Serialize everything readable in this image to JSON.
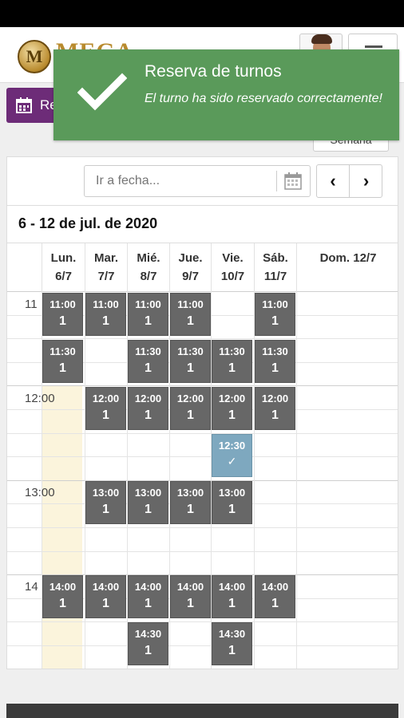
{
  "app": {
    "logo_letter": "M",
    "logo_text": "MEGA"
  },
  "tab": {
    "label": "Re"
  },
  "view_toggle": {
    "label": "Semana"
  },
  "toast": {
    "title": "Reserva de turnos",
    "message": "El turno ha sido reservado correctamente!",
    "color": "#5a9a5a"
  },
  "calendar": {
    "date_placeholder": "Ir a fecha...",
    "range_title": "6 - 12 de jul. de 2020",
    "days": [
      {
        "name": "Lun.",
        "date": "6/7"
      },
      {
        "name": "Mar.",
        "date": "7/7"
      },
      {
        "name": "Mié.",
        "date": "8/7"
      },
      {
        "name": "Jue.",
        "date": "9/7"
      },
      {
        "name": "Vie.",
        "date": "10/7"
      },
      {
        "name": "Sáb.",
        "date": "11/7"
      },
      {
        "name": "Dom. 12/7",
        "date": ""
      }
    ],
    "hours": [
      "11",
      "12:00",
      "13:00",
      "14"
    ],
    "slots": [
      {
        "day": 0,
        "row": 0,
        "time": "11:00",
        "count": "1"
      },
      {
        "day": 1,
        "row": 0,
        "time": "11:00",
        "count": "1"
      },
      {
        "day": 2,
        "row": 0,
        "time": "11:00",
        "count": "1"
      },
      {
        "day": 3,
        "row": 0,
        "time": "11:00",
        "count": "1"
      },
      {
        "day": 5,
        "row": 0,
        "time": "11:00",
        "count": "1"
      },
      {
        "day": 0,
        "row": 1,
        "time": "11:30",
        "count": "1"
      },
      {
        "day": 2,
        "row": 1,
        "time": "11:30",
        "count": "1"
      },
      {
        "day": 3,
        "row": 1,
        "time": "11:30",
        "count": "1"
      },
      {
        "day": 4,
        "row": 1,
        "time": "11:30",
        "count": "1"
      },
      {
        "day": 5,
        "row": 1,
        "time": "11:30",
        "count": "1"
      },
      {
        "day": 1,
        "row": 2,
        "time": "12:00",
        "count": "1"
      },
      {
        "day": 2,
        "row": 2,
        "time": "12:00",
        "count": "1"
      },
      {
        "day": 3,
        "row": 2,
        "time": "12:00",
        "count": "1"
      },
      {
        "day": 4,
        "row": 2,
        "time": "12:00",
        "count": "1"
      },
      {
        "day": 5,
        "row": 2,
        "time": "12:00",
        "count": "1"
      },
      {
        "day": 4,
        "row": 3,
        "time": "12:30",
        "count": "",
        "booked": true,
        "mark": "✓"
      },
      {
        "day": 1,
        "row": 4,
        "time": "13:00",
        "count": "1"
      },
      {
        "day": 2,
        "row": 4,
        "time": "13:00",
        "count": "1"
      },
      {
        "day": 3,
        "row": 4,
        "time": "13:00",
        "count": "1"
      },
      {
        "day": 4,
        "row": 4,
        "time": "13:00",
        "count": "1"
      },
      {
        "day": 0,
        "row": 6,
        "time": "14:00",
        "count": "1"
      },
      {
        "day": 1,
        "row": 6,
        "time": "14:00",
        "count": "1"
      },
      {
        "day": 2,
        "row": 6,
        "time": "14:00",
        "count": "1"
      },
      {
        "day": 3,
        "row": 6,
        "time": "14:00",
        "count": "1"
      },
      {
        "day": 4,
        "row": 6,
        "time": "14:00",
        "count": "1"
      },
      {
        "day": 5,
        "row": 6,
        "time": "14:00",
        "count": "1"
      },
      {
        "day": 2,
        "row": 7,
        "time": "14:30",
        "count": "1"
      },
      {
        "day": 4,
        "row": 7,
        "time": "14:30",
        "count": "1"
      }
    ]
  }
}
